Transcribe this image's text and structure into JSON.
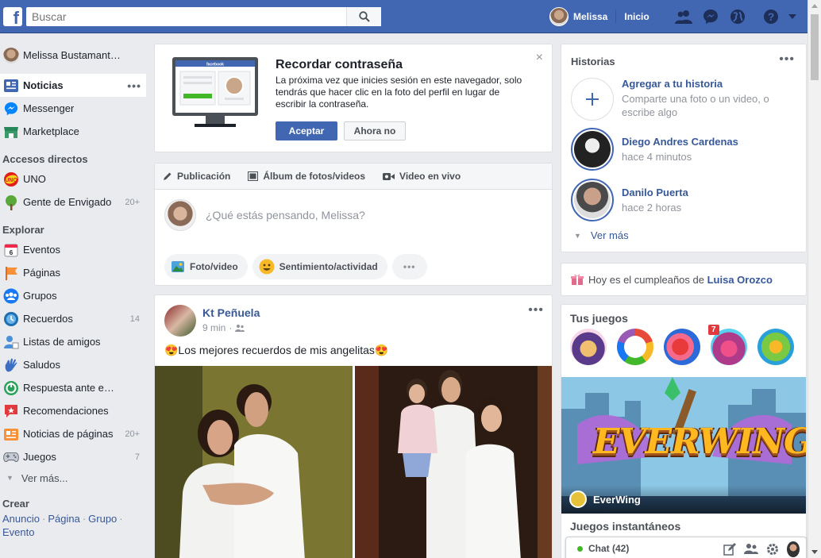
{
  "colors": {
    "brand": "#4267b2",
    "link": "#365899",
    "background": "#e9ebee",
    "online": "#42b72a"
  },
  "topbar": {
    "logo_icon": "facebook-f-icon",
    "search_placeholder": "Buscar",
    "user_name": "Melissa",
    "home_label": "Inicio",
    "icons": [
      "friend-requests-icon",
      "messenger-icon",
      "globe-notifications-icon",
      "help-question-icon",
      "dropdown-caret-icon"
    ]
  },
  "leftnav": {
    "profile": "Melissa Bustamant…",
    "main": [
      {
        "label": "Noticias",
        "icon": "news-feed-icon",
        "active": true,
        "dots": "•••"
      },
      {
        "label": "Messenger",
        "icon": "messenger-icon"
      },
      {
        "label": "Marketplace",
        "icon": "marketplace-icon"
      }
    ],
    "shortcuts_title": "Accesos directos",
    "shortcuts": [
      {
        "label": "UNO",
        "icon": "uno-game-icon"
      },
      {
        "label": "Gente de Envigado",
        "icon": "tree-group-icon",
        "count": "20+"
      }
    ],
    "explore_title": "Explorar",
    "explore": [
      {
        "label": "Eventos",
        "icon": "calendar-icon"
      },
      {
        "label": "Páginas",
        "icon": "flag-icon"
      },
      {
        "label": "Grupos",
        "icon": "groups-icon"
      },
      {
        "label": "Recuerdos",
        "icon": "memories-clock-icon",
        "count": "14"
      },
      {
        "label": "Listas de amigos",
        "icon": "friend-lists-icon"
      },
      {
        "label": "Saludos",
        "icon": "wave-hand-icon"
      },
      {
        "label": "Respuesta ante em…",
        "icon": "crisis-response-icon"
      },
      {
        "label": "Recomendaciones",
        "icon": "recommendations-icon"
      },
      {
        "label": "Noticias de páginas",
        "icon": "pages-feed-icon",
        "count": "20+"
      },
      {
        "label": "Juegos",
        "icon": "gamepad-icon",
        "count": "7"
      }
    ],
    "see_more": "Ver más...",
    "create_title": "Crear",
    "create_links": [
      "Anuncio",
      "Página",
      "Grupo",
      "Evento"
    ]
  },
  "password_prompt": {
    "title": "Recordar contraseña",
    "body": "La próxima vez que inicies sesión en este navegador, solo tendrás que hacer clic en la foto del perfil en lugar de escribir la contraseña.",
    "accept": "Aceptar",
    "decline": "Ahora no",
    "close": "×",
    "illustration_title": "facebook"
  },
  "composer": {
    "tabs": [
      {
        "label": "Publicación",
        "icon": "pencil-icon"
      },
      {
        "label": "Álbum de fotos/videos",
        "icon": "album-icon"
      },
      {
        "label": "Video en vivo",
        "icon": "live-video-icon"
      }
    ],
    "placeholder": "¿Qué estás pensando, Melissa?",
    "actions": [
      {
        "label": "Foto/video",
        "icon": "photo-icon"
      },
      {
        "label": "Sentimiento/actividad",
        "icon": "smiley-icon"
      }
    ],
    "more": "•••"
  },
  "post": {
    "author": "Kt Peñuela",
    "time": "9 min",
    "audience_icon": "friends-audience-icon",
    "text": "😍Los mejores recuerdos de mis angelitas😍",
    "dots": "•••"
  },
  "stories": {
    "title": "Historias",
    "dots": "•••",
    "add_title": "Agregar a tu historia",
    "add_sub": "Comparte una foto o un video, o escribe algo",
    "items": [
      {
        "name": "Diego Andres Cardenas",
        "time": "hace 4 minutos"
      },
      {
        "name": "Danilo Puerta",
        "time": "hace 2 horas"
      }
    ],
    "see_more": "Ver más"
  },
  "birthday": {
    "prefix": "Hoy es el cumpleaños de",
    "name": "Luisa Orozco"
  },
  "games": {
    "title": "Tus juegos",
    "icons": [
      "game-1-icon",
      "game-2-icon",
      "candy-crush-icon",
      "game-4-icon",
      "game-5-icon"
    ],
    "badge": "7",
    "banner_logo": "EVERWING",
    "banner_label": "EverWing",
    "instant_title": "Juegos instantáneos"
  },
  "chat": {
    "label": "Chat (42)",
    "icons": [
      "compose-icon",
      "add-group-icon",
      "settings-gear-icon"
    ]
  }
}
